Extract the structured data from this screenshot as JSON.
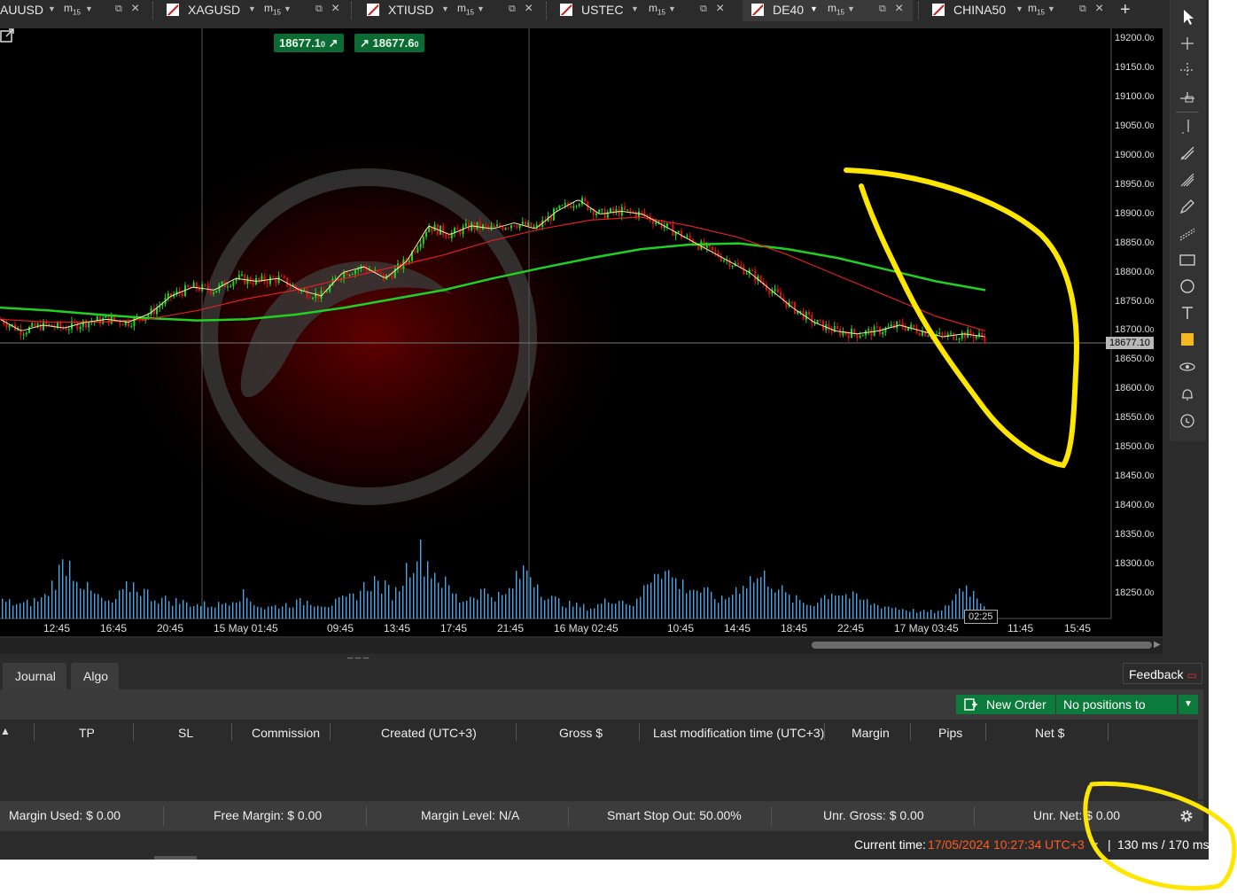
{
  "tabs": [
    {
      "symbol": "AUUSD",
      "timeframe": "m",
      "timeframe_sub": "15",
      "active": false
    },
    {
      "symbol": "XAGUSD",
      "timeframe": "m",
      "timeframe_sub": "15",
      "active": false
    },
    {
      "symbol": "XTIUSD",
      "timeframe": "m",
      "timeframe_sub": "15",
      "active": false
    },
    {
      "symbol": "USTEC",
      "timeframe": "m",
      "timeframe_sub": "15",
      "active": false
    },
    {
      "symbol": "DE40",
      "timeframe": "m",
      "timeframe_sub": "15",
      "active": true
    },
    {
      "symbol": "CHINA50",
      "timeframe": "m",
      "timeframe_sub": "15",
      "active": false
    }
  ],
  "chart": {
    "sell_price": "18677.1",
    "sell_price_sub": "0",
    "buy_price": "18677.6",
    "buy_price_sub": "0",
    "current_price_label": "18677.10",
    "current_time_label": "02:25",
    "price_axis": [
      {
        "label": "19200.0",
        "sub": "0",
        "value": 19200
      },
      {
        "label": "19150.0",
        "sub": "0",
        "value": 19150
      },
      {
        "label": "19100.0",
        "sub": "0",
        "value": 19100
      },
      {
        "label": "19050.0",
        "sub": "0",
        "value": 19050
      },
      {
        "label": "19000.0",
        "sub": "0",
        "value": 19000
      },
      {
        "label": "18950.0",
        "sub": "0",
        "value": 18950
      },
      {
        "label": "18900.0",
        "sub": "0",
        "value": 18900
      },
      {
        "label": "18850.0",
        "sub": "0",
        "value": 18850
      },
      {
        "label": "18800.0",
        "sub": "0",
        "value": 18800
      },
      {
        "label": "18750.0",
        "sub": "0",
        "value": 18750
      },
      {
        "label": "18700.0",
        "sub": "0",
        "value": 18700
      },
      {
        "label": "18650.0",
        "sub": "0",
        "value": 18650
      },
      {
        "label": "18600.0",
        "sub": "0",
        "value": 18600
      },
      {
        "label": "18550.0",
        "sub": "0",
        "value": 18550
      },
      {
        "label": "18500.0",
        "sub": "0",
        "value": 18500
      },
      {
        "label": "18450.0",
        "sub": "0",
        "value": 18450
      },
      {
        "label": "18400.0",
        "sub": "0",
        "value": 18400
      },
      {
        "label": "18350.0",
        "sub": "0",
        "value": 18350
      },
      {
        "label": "18300.0",
        "sub": "0",
        "value": 18300
      },
      {
        "label": "18250.0",
        "sub": "0",
        "value": 18250
      }
    ],
    "time_axis": [
      "12:45",
      "16:45",
      "20:45",
      "15 May 01:45",
      "09:45",
      "13:45",
      "17:45",
      "21:45",
      "16 May 02:45",
      "10:45",
      "14:45",
      "18:45",
      "22:45",
      "17 May 03:45",
      "11:45",
      "15:45"
    ],
    "price_trace": [
      18720,
      18700,
      18710,
      18705,
      18715,
      18720,
      18715,
      18730,
      18760,
      18775,
      18770,
      18790,
      18785,
      18790,
      18770,
      18760,
      18800,
      18810,
      18790,
      18820,
      18880,
      18865,
      18880,
      18875,
      18885,
      18875,
      18905,
      18925,
      18900,
      18905,
      18900,
      18880,
      18860,
      18840,
      18820,
      18800,
      18770,
      18740,
      18715,
      18700,
      18695,
      18700,
      18710,
      18700,
      18690,
      18695,
      18690
    ],
    "ma_slow": [
      18740,
      18735,
      18728,
      18722,
      18718,
      18720,
      18728,
      18740,
      18755,
      18770,
      18790,
      18808,
      18825,
      18840,
      18848,
      18850,
      18840,
      18825,
      18805,
      18785,
      18770
    ],
    "ma_mid": [
      18720,
      18715,
      18715,
      18720,
      18735,
      18755,
      18770,
      18790,
      18810,
      18830,
      18855,
      18875,
      18890,
      18895,
      18880,
      18860,
      18830,
      18795,
      18760,
      18725,
      18700
    ],
    "volumes": [
      0.25,
      0.2,
      0.3,
      0.85,
      0.4,
      0.2,
      0.5,
      0.3,
      0.25,
      0.2,
      0.2,
      0.35,
      0.15,
      0.2,
      0.25,
      0.2,
      0.3,
      0.55,
      0.35,
      1.0,
      0.6,
      0.25,
      0.4,
      0.3,
      0.75,
      0.3,
      0.2,
      0.15,
      0.3,
      0.2,
      0.8,
      0.5,
      0.4,
      0.25,
      0.55,
      0.6,
      0.3,
      0.2,
      0.4,
      0.3,
      0.2,
      0.15,
      0.1,
      0.1,
      0.5,
      0.2
    ]
  },
  "bottom_tabs": [
    {
      "label": "Journal"
    },
    {
      "label": "Algo"
    }
  ],
  "feedback_label": "Feedback",
  "new_order_label": "New Order",
  "no_positions_label": "No positions to close",
  "columns": [
    "TP",
    "SL",
    "Commission",
    "Created (UTC+3)",
    "Gross $",
    "Last modification time (UTC+3)",
    "Margin",
    "Pips",
    "Net $"
  ],
  "stats": {
    "margin_used_label": "Margin Used:",
    "margin_used_value": "$ 0.00",
    "free_margin_label": "Free Margin:",
    "free_margin_value": "$ 0.00",
    "margin_level_label": "Margin Level:",
    "margin_level_value": "N/A",
    "smart_stop_label": "Smart Stop Out:",
    "smart_stop_value": "50.00%",
    "unr_gross_label": "Unr. Gross:",
    "unr_gross_value": "$ 0.00",
    "unr_net_label": "Unr. Net:",
    "unr_net_value": "$ 0.00"
  },
  "status": {
    "current_time_label": "Current time:",
    "current_time_value": "17/05/2024 10:27:34",
    "timezone": "UTC+3",
    "latency": "130 ms / 170 ms"
  },
  "colors": {
    "accent_green": "#0b7a3a",
    "up_candle": "#1fd41f",
    "down_candle": "#e01010",
    "ma_green": "#22d022",
    "ma_red": "#e02020",
    "annotation": "#ffe600",
    "time_orange": "#ff5b24"
  }
}
